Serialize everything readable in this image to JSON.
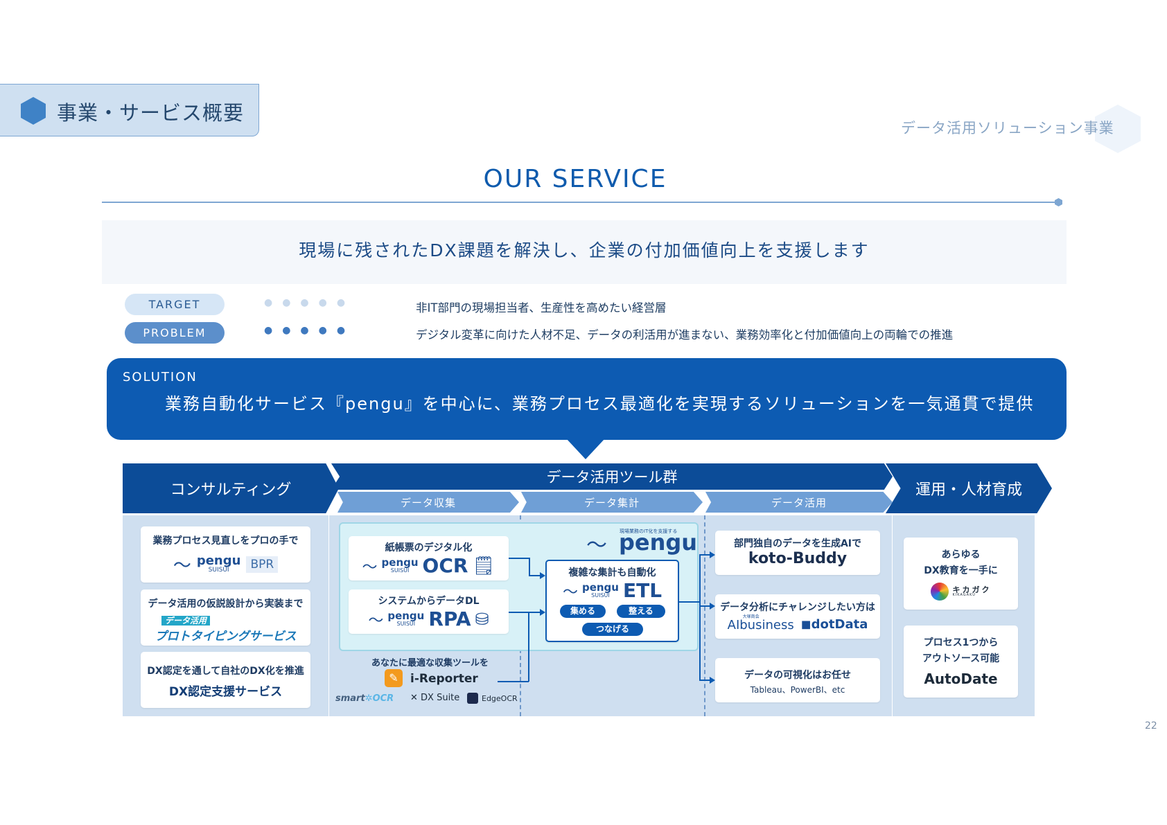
{
  "header": {
    "section_label": "事業・サービス概要",
    "category_label": "データ活用ソリューション事業"
  },
  "title": "OUR SERVICE",
  "tagline": "現場に残されたDX課題を解決し、企業の付加価値向上を支援します",
  "target": {
    "label": "TARGET",
    "text": "非IT部門の現場担当者、生産性を高めたい経営層"
  },
  "problem": {
    "label": "PROBLEM",
    "text": "デジタル変革に向けた人材不足、データの利活用が進まない、業務効率化と付加価値向上の両輪での推進"
  },
  "solution": {
    "label": "SOLUTION",
    "text": "業務自動化サービス『pengu』を中心に、業務プロセス最適化を実現するソリューションを一気通貫で提供"
  },
  "flow": {
    "consulting": "コンサルティング",
    "tools": "データ活用ツール群",
    "operations": "運用・人材育成",
    "sub_collect": "データ収集",
    "sub_aggregate": "データ集計",
    "sub_use": "データ活用"
  },
  "consulting_cards": [
    {
      "heading": "業務プロセス見直しをプロの手で",
      "logo_text": "pengu",
      "logo_sub": "SUISUI",
      "badge": "BPR"
    },
    {
      "heading": "データ活用の仮説設計から実装まで",
      "tag": "データ活用",
      "body": "プロトタイピングサービス"
    },
    {
      "heading": "DX認定を通して自社のDX化を推進",
      "body": "DX認定支援サービス"
    }
  ],
  "pengu": {
    "brand_small": "現場業務のIT化を支援する",
    "brand": "pengu",
    "ocr": {
      "heading": "紙帳票のデジタル化",
      "logo": "pengu",
      "logo_sub": "SUISUI",
      "product": "OCR"
    },
    "rpa": {
      "heading": "システムからデータDL",
      "logo": "pengu",
      "logo_sub": "SUISUI",
      "product": "RPA"
    },
    "etl": {
      "heading": "複雑な集計も自動化",
      "logo": "pengu",
      "logo_sub": "SUISUI",
      "product": "ETL",
      "buttons": [
        "集める",
        "整える",
        "つなげる"
      ]
    }
  },
  "collect_tools": {
    "heading": "あなたに最適な収集ツールを",
    "main": "i-Reporter",
    "others": [
      "smart",
      "OCR",
      "DX Suite",
      "EdgeOCR"
    ]
  },
  "use_cards": [
    {
      "heading": "部門独自のデータを生成AIで",
      "body": "koto-Buddy"
    },
    {
      "heading": "データ分析にチャレンジしたい方は",
      "logo_small": "大塚商会",
      "logo1": "AIbusiness",
      "logo2": "dotData"
    },
    {
      "heading": "データの可視化はお任せ",
      "body": "Tableau、PowerBI、etc"
    }
  ],
  "ops_cards": [
    {
      "heading_line1": "あらゆる",
      "heading_line2": "DX教育を一手に",
      "logo": "キカガク",
      "logo_sub": "KIKAGAKU"
    },
    {
      "heading_line1": "プロセス1つから",
      "heading_line2": "アウトソース可能",
      "logo": "AutoDate"
    }
  ],
  "page_number": "22",
  "colors": {
    "primary": "#0d5bb2",
    "dark": "#0c4c98",
    "light_panel": "#cfdff0",
    "pengu_area": "#d8f1f7"
  }
}
